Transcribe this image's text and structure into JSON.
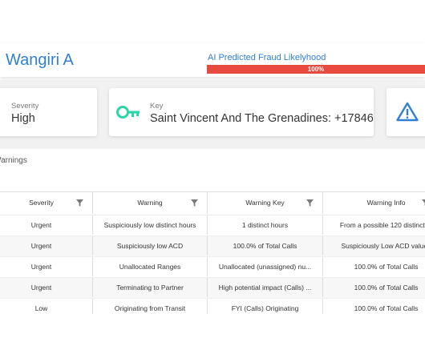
{
  "header": {
    "title": "Wangiri A",
    "fraud_label": "AI Predicted Fraud Likelyhood",
    "fraud_pct_text": "100%",
    "fraud_pct_value": 100
  },
  "cards": {
    "severity": {
      "label": "Severity",
      "value": "High"
    },
    "key": {
      "label": "Key",
      "value": "Saint Vincent And The Grenadines: +17846",
      "icon": "key-icon"
    },
    "alert": {
      "icon": "warning-icon"
    }
  },
  "colors": {
    "accent": "#2f80d1",
    "danger": "#e84a3f",
    "key_icon": "#2dd4a8"
  },
  "warnings": {
    "section_title": "Warnings",
    "columns": [
      "Severity",
      "Warning",
      "Warning Key",
      "Warning Info"
    ],
    "rows": [
      [
        "Urgent",
        "Suspiciously low distinct hours",
        "1 distinct hours",
        "From a possible 120 distinct ..."
      ],
      [
        "Urgent",
        "Suspiciously low ACD",
        "100.0% of Total Calls",
        "Suspiciously Low ACD values"
      ],
      [
        "Urgent",
        "Unallocated Ranges",
        "Unallocated (unassigned) nu...",
        "100.0% of Total Calls"
      ],
      [
        "Urgent",
        "Terminating to Partner",
        "High potential impact (Calls) ...",
        "100.0% of Total Calls"
      ],
      [
        "Low",
        "Originating from Transit",
        "FYI (Calls) Originating",
        "100.0% of Total Calls"
      ]
    ]
  }
}
